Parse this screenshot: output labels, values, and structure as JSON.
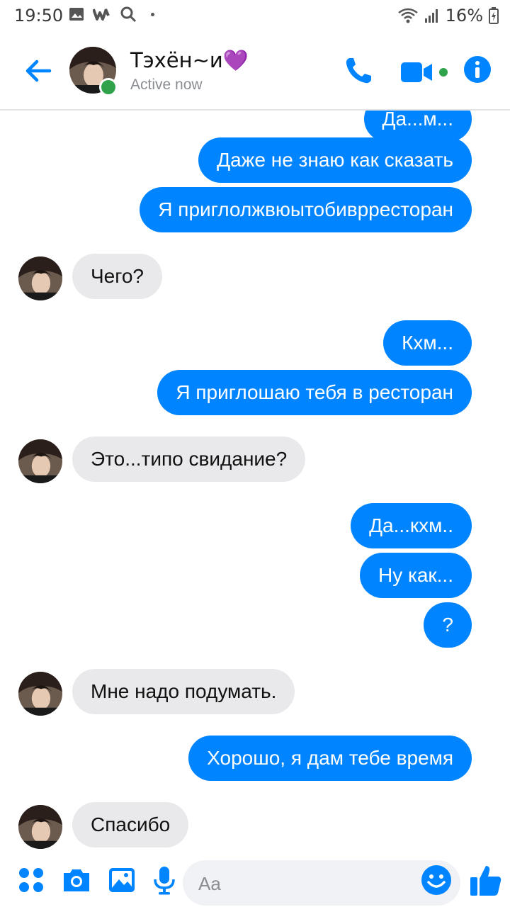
{
  "status_bar": {
    "time": "19:50",
    "battery": "16%"
  },
  "header": {
    "contact_name": "Тэхён~и💜",
    "status": "Active now"
  },
  "messages": [
    {
      "from": "me",
      "text": "Да...м..."
    },
    {
      "from": "me",
      "text": "Даже не знаю как сказать"
    },
    {
      "from": "me",
      "text": "Я приглолжвюытобиврресторан"
    },
    {
      "from": "them",
      "text": "Чего?"
    },
    {
      "from": "me",
      "text": "Кхм..."
    },
    {
      "from": "me",
      "text": "Я приглошаю тебя в ресторан"
    },
    {
      "from": "them",
      "text": "Это...типо свидание?"
    },
    {
      "from": "me",
      "text": "Да...кхм.."
    },
    {
      "from": "me",
      "text": "Ну как..."
    },
    {
      "from": "me",
      "text": "?"
    },
    {
      "from": "them",
      "text": "Мне надо подумать."
    },
    {
      "from": "me",
      "text": "Хорошо, я дам тебе время"
    },
    {
      "from": "them",
      "text": "Спасибо"
    }
  ],
  "composer": {
    "placeholder": "Aa"
  },
  "colors": {
    "accent": "#0084ff",
    "incoming_bubble": "#e9e9eb",
    "online": "#31a24c"
  },
  "icons": [
    "back-arrow",
    "phone",
    "video-camera",
    "info",
    "apps",
    "camera",
    "image",
    "microphone",
    "emoji",
    "thumbs-up"
  ]
}
